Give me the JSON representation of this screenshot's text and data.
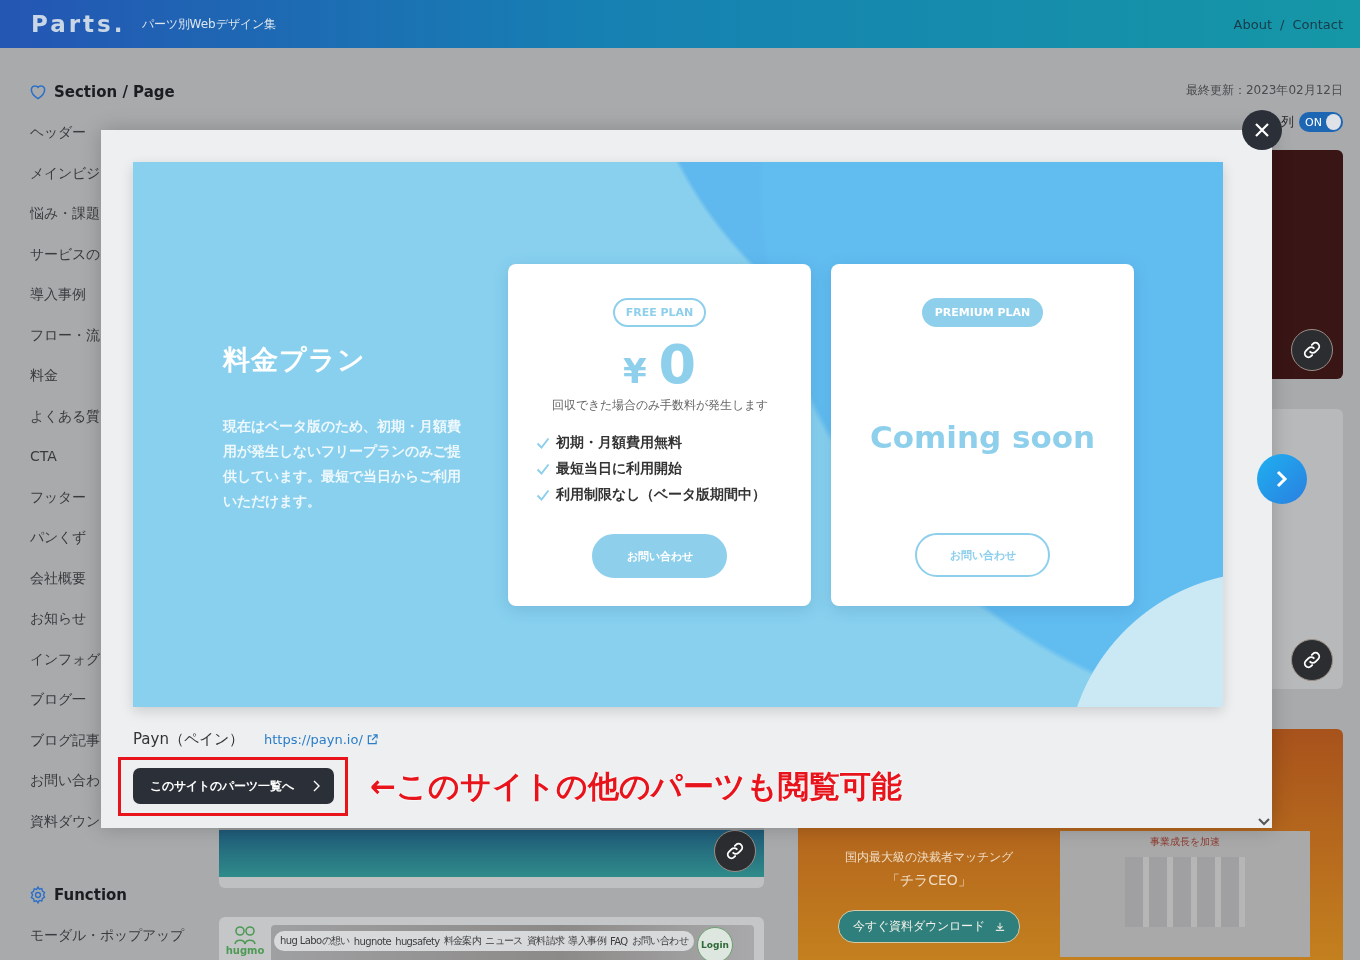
{
  "header": {
    "logo": "Parts.",
    "tagline": "パーツ別Webデザイン集",
    "nav": [
      {
        "label": "About"
      },
      {
        "label": "Contact"
      }
    ],
    "nav_separator": "/"
  },
  "sidebar": {
    "sections": [
      {
        "kind": "page",
        "title": "Section / Page",
        "items": [
          "ヘッダー",
          "メインビジ",
          "悩み・課題",
          "サービスの",
          "導入事例",
          "フロー・流",
          "料金",
          "よくある質",
          "CTA",
          "フッター",
          "パンくず",
          "会社概要",
          "お知らせ",
          "インフォグ",
          "ブログ一",
          "ブログ記事",
          "お問い合わ",
          "資料ダウン"
        ]
      },
      {
        "kind": "function",
        "title": "Function",
        "items": [
          "モーダル・ポップアップ"
        ]
      }
    ]
  },
  "toolbar": {
    "updated": "最終更新：2023年02月12日",
    "column_label": "列",
    "toggle": {
      "label": "ON",
      "on": true
    }
  },
  "gallery": {
    "columns": [
      [
        {
          "kind": "teal",
          "link_button": true
        },
        {
          "kind": "hugmo",
          "logo": "hugmo",
          "nav": [
            "hug Laboの想い",
            "hugnote",
            "hugsafety",
            "料金案内",
            "ニュース",
            "資料請求",
            "導入事例",
            "FAQ",
            "お問い合わせ"
          ],
          "login": "Login"
        }
      ],
      [
        {
          "kind": "maroon",
          "link_button": true
        },
        {
          "kind": "light",
          "link_button": true
        },
        {
          "kind": "orange",
          "headline": "国内最大級の決裁者マッチング",
          "product": "「チラCEO」",
          "cta": "今すぐ資料ダウンロード",
          "thumb_title": "事業成長を加速"
        }
      ]
    ]
  },
  "modal": {
    "preview": {
      "title": "料金プラン",
      "description": "現在はベータ版のため、初期・月額費用が発生しないフリープランのみご提供しています。最短で当日からご利用いただけます。",
      "plans": [
        {
          "kind": "price",
          "badge": "FREE PLAN",
          "badge_filled": false,
          "currency": "¥",
          "price": "0",
          "note": "回収できた場合のみ手数料が発生します",
          "features": [
            "初期・月額費用無料",
            "最短当日に利用開始",
            "利用制限なし（ベータ版期間中）"
          ],
          "button": "お問い合わせ",
          "button_filled": true
        },
        {
          "kind": "coming",
          "badge": "PREMIUM PLAN",
          "badge_filled": true,
          "message": "Coming soon",
          "button": "お問い合わせ",
          "button_filled": false
        }
      ]
    },
    "site_name": "Payn（ペイン）",
    "site_url": "https://payn.io/",
    "parts_button": "このサイトのパーツ一覧へ"
  },
  "annotation": {
    "text": "←このサイトの他のパーツも閲覧可能"
  }
}
